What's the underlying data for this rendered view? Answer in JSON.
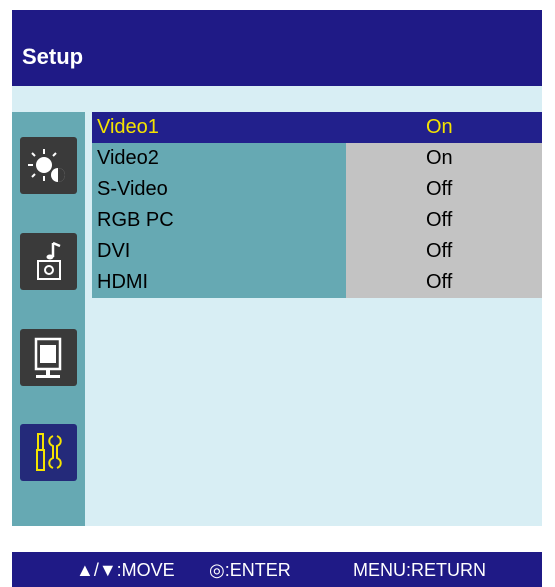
{
  "header": {
    "title": "Setup"
  },
  "sidebar": {
    "items": [
      {
        "icon": "brightness-contrast-icon",
        "selected": false
      },
      {
        "icon": "music-audio-icon",
        "selected": false
      },
      {
        "icon": "monitor-display-icon",
        "selected": false
      },
      {
        "icon": "tools-setup-icon",
        "selected": true
      }
    ]
  },
  "menu": {
    "rows": [
      {
        "label": "Video1",
        "value": "On"
      },
      {
        "label": "Video2",
        "value": "On"
      },
      {
        "label": "S-Video",
        "value": "Off"
      },
      {
        "label": "RGB PC",
        "value": "Off"
      },
      {
        "label": "DVI",
        "value": "Off"
      },
      {
        "label": "HDMI",
        "value": "Off"
      }
    ],
    "selected_index": 0
  },
  "footer": {
    "move": "▲/▼:MOVE",
    "enter": "◎:ENTER",
    "return": "MENU:RETURN"
  },
  "colors": {
    "navy": "#1f1a86",
    "highlight_text": "#f5e300",
    "teal": "#66a9b3",
    "grey": "#c3c3c3",
    "panel": "#d8eef4"
  }
}
